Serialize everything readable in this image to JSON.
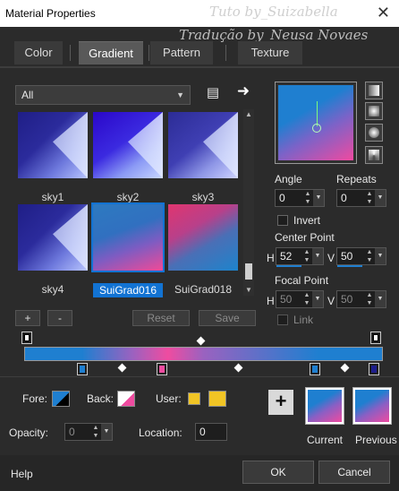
{
  "window": {
    "title": "Material Properties",
    "close": "✕"
  },
  "watermark": {
    "line1": "Tuto by_Suizabella",
    "line2": "Tradução by_Neusa Novaes"
  },
  "tabs": [
    "Color",
    "Gradient",
    "Pattern",
    "Texture"
  ],
  "active_tab": "Gradient",
  "category": {
    "value": "All"
  },
  "gradients": [
    {
      "label": "sky1"
    },
    {
      "label": "sky2"
    },
    {
      "label": "sky3"
    },
    {
      "label": "sky4"
    },
    {
      "label": "SuiGrad016",
      "selected": true
    },
    {
      "label": "SuiGrad018"
    }
  ],
  "actions": {
    "add": "+",
    "remove": "-",
    "reset": "Reset",
    "save": "Save"
  },
  "settings": {
    "angle_label": "Angle",
    "angle_value": "0",
    "repeats_label": "Repeats",
    "repeats_value": "0",
    "invert_label": "Invert",
    "center_label": "Center Point",
    "center_h_label": "H",
    "center_h": "52",
    "center_v_label": "V",
    "center_v": "50",
    "focal_label": "Focal Point",
    "focal_h_label": "H",
    "focal_h": "50",
    "focal_v_label": "V",
    "focal_v": "50",
    "link_label": "Link"
  },
  "bottom": {
    "fore_label": "Fore:",
    "back_label": "Back:",
    "user_label": "User:",
    "opacity_label": "Opacity:",
    "opacity_value": "0",
    "location_label": "Location:",
    "location_value": "0",
    "current_label": "Current",
    "previous_label": "Previous",
    "add_label": "+"
  },
  "footer": {
    "help": "Help",
    "ok": "OK",
    "cancel": "Cancel"
  },
  "colors": {
    "accent": "#1273d3",
    "grad_blue": "#1f7fd0",
    "grad_pink": "#ef4ca0",
    "user_yellow": "#f1c525"
  }
}
